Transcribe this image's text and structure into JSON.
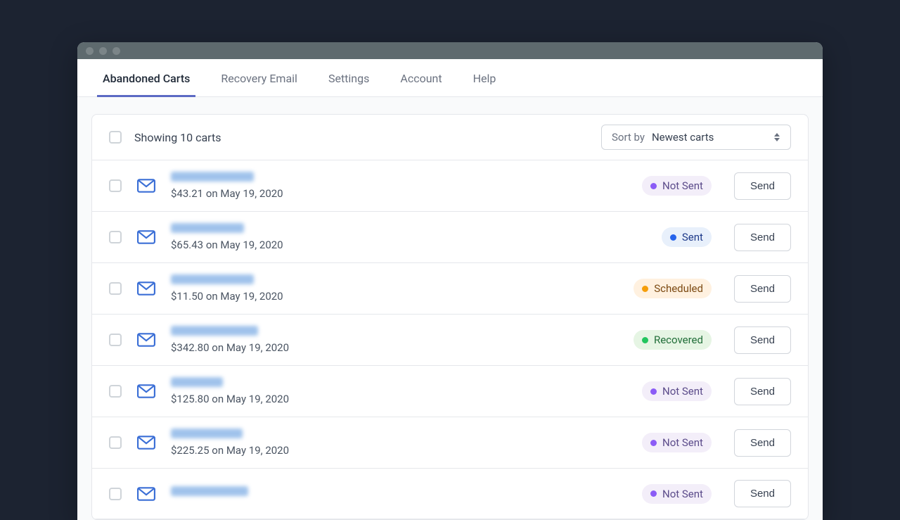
{
  "tabs": [
    {
      "label": "Abandoned Carts",
      "active": true
    },
    {
      "label": "Recovery Email",
      "active": false
    },
    {
      "label": "Settings",
      "active": false
    },
    {
      "label": "Account",
      "active": false
    },
    {
      "label": "Help",
      "active": false
    }
  ],
  "summary": "Showing 10 carts",
  "sort": {
    "label": "Sort by",
    "value": "Newest carts"
  },
  "send_label": "Send",
  "rows": [
    {
      "name_width": 118,
      "amount": "$43.21",
      "date": "May 19, 2020",
      "status": "Not Sent",
      "status_class": "not-sent"
    },
    {
      "name_width": 104,
      "amount": "$65.43",
      "date": "May 19, 2020",
      "status": "Sent",
      "status_class": "sent"
    },
    {
      "name_width": 118,
      "amount": "$11.50",
      "date": "May 19, 2020",
      "status": "Scheduled",
      "status_class": "scheduled"
    },
    {
      "name_width": 124,
      "amount": "$342.80",
      "date": "May 19, 2020",
      "status": "Recovered",
      "status_class": "recovered"
    },
    {
      "name_width": 74,
      "amount": "$125.80",
      "date": "May 19, 2020",
      "status": "Not Sent",
      "status_class": "not-sent"
    },
    {
      "name_width": 102,
      "amount": "$225.25",
      "date": "May 19, 2020",
      "status": "Not Sent",
      "status_class": "not-sent"
    },
    {
      "name_width": 110,
      "amount": "",
      "date": "",
      "status": "Not Sent",
      "status_class": "not-sent"
    }
  ]
}
